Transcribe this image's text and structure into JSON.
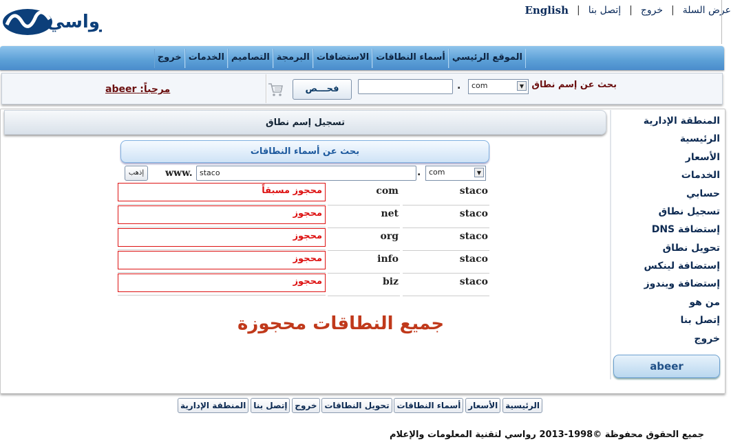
{
  "top_links": {
    "cart": "عرض السلة",
    "logout": "خروج",
    "contact": "إتصل بنا",
    "english": "English",
    "separator": "|"
  },
  "logo": {
    "brand": "رواسي"
  },
  "nav": {
    "items": [
      "الموقع الرئيسي",
      "أسماء النطاقات",
      "الاستضافات",
      "البرمجة",
      "التصاميم",
      "الخدمات",
      "خروج"
    ]
  },
  "search": {
    "label": "بحث عن إسم نطاق",
    "tld": "com",
    "value": "",
    "dot": ".",
    "button": "فحـــص",
    "welcome_label": "مرحباً:",
    "welcome_user": "abeer"
  },
  "sidebar": {
    "items": [
      "المنطقة الإدارية",
      "الرئيسية",
      "الأسعار",
      "الخدمات",
      "حسابي",
      "تسجيل نطاق",
      "إستضافة DNS",
      "تحويل نطاق",
      "إستضافة لينكس",
      "إستضافة ويندوز",
      "من هو",
      "إتصل بنا",
      "خروج"
    ],
    "user": "abeer"
  },
  "content": {
    "title": "تسجيل إسم نطاق",
    "search_title": "بحث عن أسماء النطاقات",
    "tld": "com",
    "domain_value": "staco",
    "www": "www.",
    "dot": ".",
    "go": "إذهب",
    "results": [
      {
        "name": "staco",
        "tld": "com",
        "status": "محجوز مسبقاً"
      },
      {
        "name": "staco",
        "tld": "net",
        "status": "محجوز"
      },
      {
        "name": "staco",
        "tld": "org",
        "status": "محجوز"
      },
      {
        "name": "staco",
        "tld": "info",
        "status": "محجوز"
      },
      {
        "name": "staco",
        "tld": "biz",
        "status": "محجوز"
      }
    ],
    "all_taken": "جميع النطاقات محجوزة"
  },
  "footer": {
    "links": [
      "المنطقة الإدارية",
      "إتصل بنا",
      "خروج",
      "تحويل النطاقات",
      "أسماء النطاقات",
      "الأسعار",
      "الرئيسية"
    ],
    "copyright": "جميع الحقوق محفوظة  ©1998-2013 رواسي لتقنية المعلومات والإعلام"
  },
  "colors": {
    "nav_bg": "#5b9fd6",
    "maroon_text": "#6a0e0e",
    "taken_red": "#d11111",
    "heading_orange": "#c0391b",
    "link_blue": "#0d2a52"
  }
}
